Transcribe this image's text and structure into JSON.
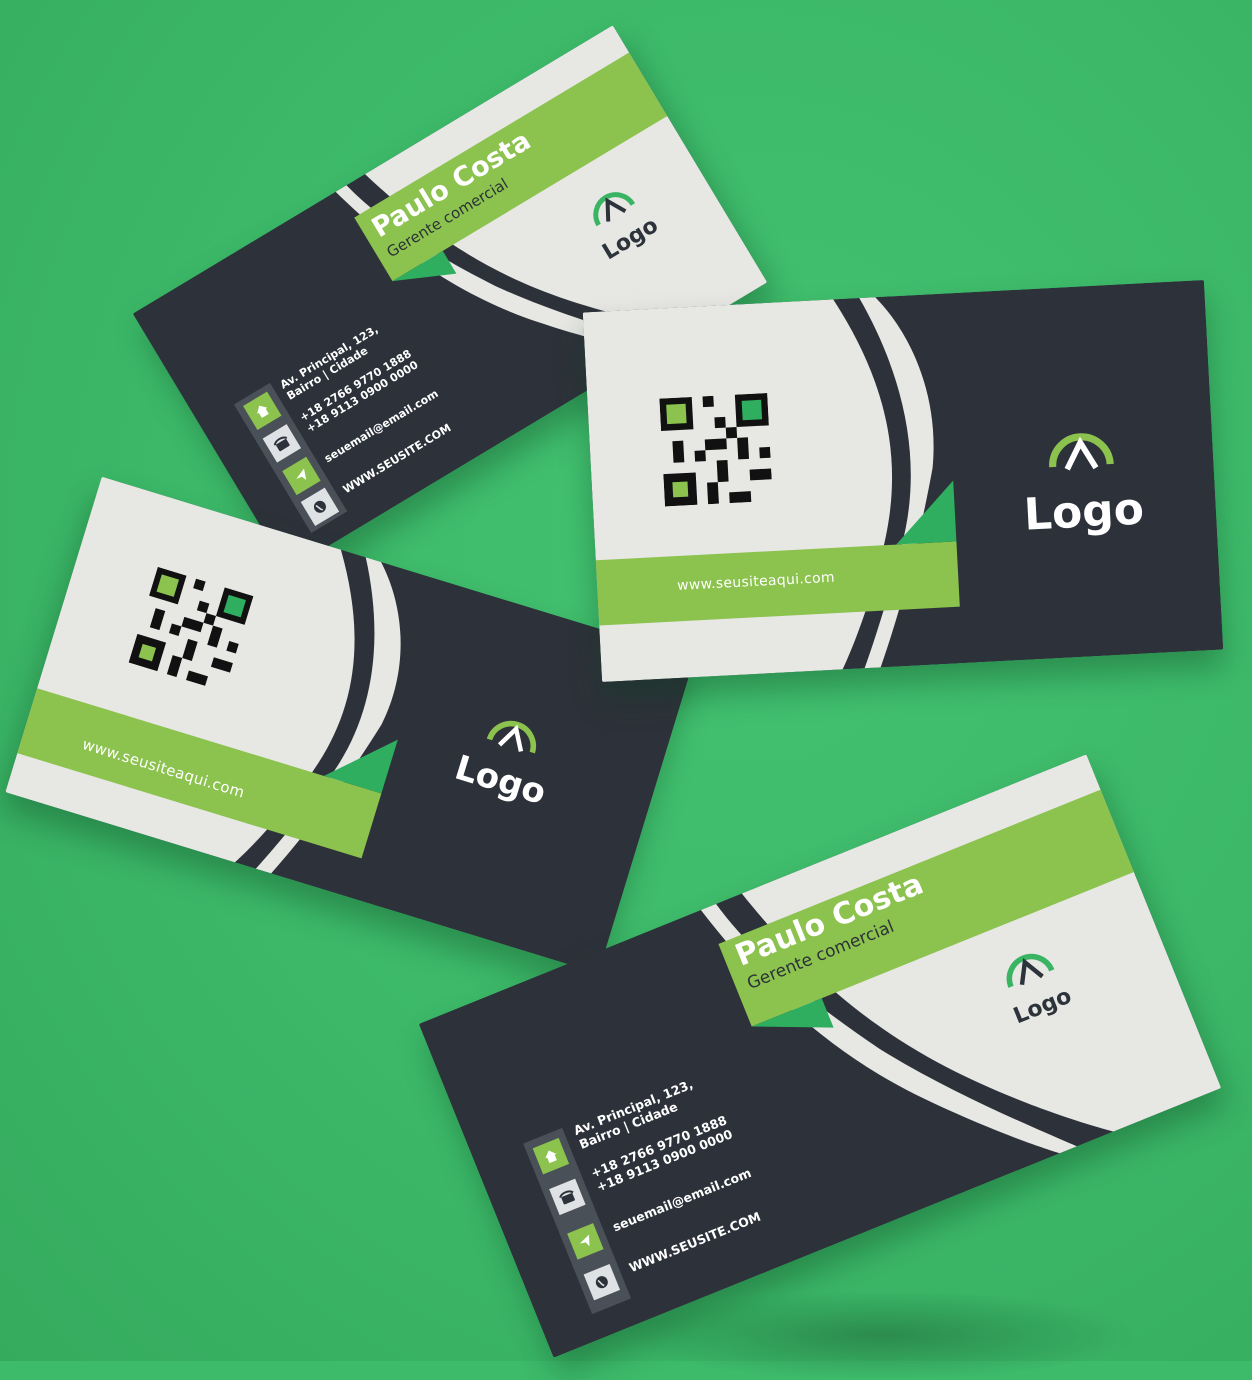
{
  "colors": {
    "background_green": "#3dba6a",
    "card_dark": "#2d323a",
    "card_light": "#e7e7e4",
    "accent_green": "#8cc24e",
    "accent_deep_green": "#2fae5f"
  },
  "brand": {
    "logo_text": "Logo"
  },
  "front": {
    "name": "Paulo Costa",
    "role": "Gerente comercial",
    "address_line1": "Av. Principal, 123,",
    "address_line2": "Bairro | Cidade",
    "phone1": "+18 2766 9770 1888",
    "phone2": "+18 9113 0900 0000",
    "email": "seuemail@email.com",
    "website": "WWW.SEUSITE.COM",
    "icons": [
      "home-icon",
      "phone-icon",
      "send-icon",
      "globe-icon"
    ]
  },
  "back": {
    "website": "www.seusiteaqui.com",
    "qr_icon": "qr-code-icon"
  }
}
